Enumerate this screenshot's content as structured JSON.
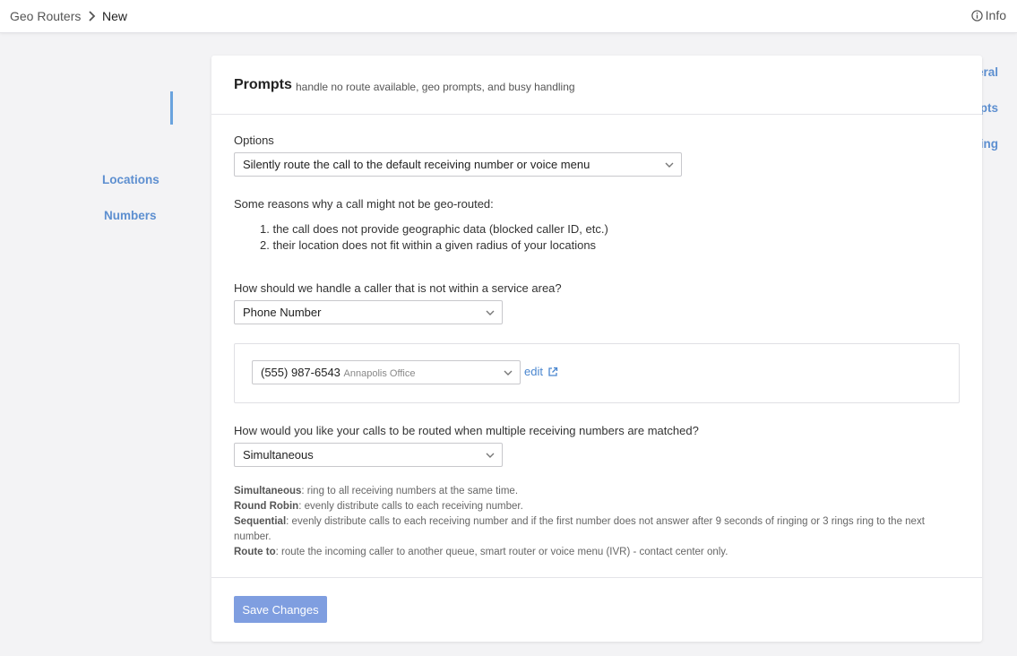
{
  "breadcrumb": {
    "root": "Geo Routers",
    "current": "New"
  },
  "header": {
    "info_label": "Info"
  },
  "sidebar": {
    "items": [
      {
        "label": "General"
      },
      {
        "label": "Prompts"
      },
      {
        "label": "Routing"
      },
      {
        "label": "Locations"
      },
      {
        "label": "Numbers"
      }
    ],
    "active": "Prompts"
  },
  "card": {
    "title": "Prompts",
    "subtitle": "handle no route available, geo prompts, and busy handling"
  },
  "options": {
    "label": "Options",
    "selected": "Silently route the call to the default receiving number or voice menu"
  },
  "reasons": {
    "intro": "Some reasons why a call might not be geo-routed:",
    "items": [
      "1. the call does not provide geographic data (blocked caller ID, etc.)",
      "2. their location does not fit within a given radius of your locations"
    ]
  },
  "service_area": {
    "label": "How should we handle a caller that is not within a service area?",
    "selected": "Phone Number"
  },
  "phone_select": {
    "number": "(555) 987-6543",
    "location": "Annapolis Office",
    "edit_label": "edit"
  },
  "routing": {
    "label": "How would you like your calls to be routed when multiple receiving numbers are matched?",
    "selected": "Simultaneous"
  },
  "help": {
    "simultaneous_term": "Simultaneous",
    "simultaneous_desc": ": ring to all receiving numbers at the same time.",
    "round_robin_term": "Round Robin",
    "round_robin_desc": ": evenly distribute calls to each receiving number.",
    "sequential_term": "Sequential",
    "sequential_desc": ": evenly distribute calls to each receiving number and if the first number does not answer after 9 seconds of ringing or 3 rings ring to the next number.",
    "route_to_term": "Route to",
    "route_to_desc": ": route the incoming caller to another queue, smart router or voice menu (IVR) - contact center only."
  },
  "footer": {
    "save_label": "Save Changes"
  },
  "colors": {
    "link": "#5d8fd0",
    "accent_bar": "#6aa3de",
    "save_button": "#7f9ee0"
  }
}
